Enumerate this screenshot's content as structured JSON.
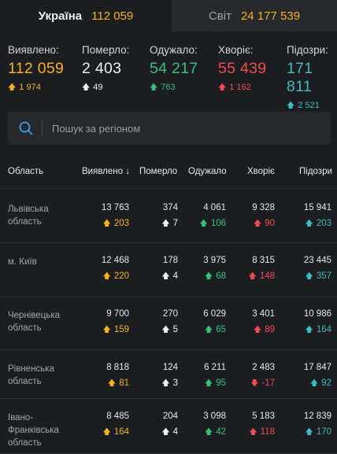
{
  "tabs": {
    "ukraine": {
      "label": "Україна",
      "count": "112 059"
    },
    "world": {
      "label": "Світ",
      "count": "24 177 539"
    }
  },
  "stats": [
    {
      "label": "Виявлено:",
      "value": "112 059",
      "delta": "1 974",
      "color": "#f6b21b",
      "arrow": "up"
    },
    {
      "label": "Померло:",
      "value": "2 403",
      "delta": "49",
      "color": "#eef0f2",
      "arrow": "up"
    },
    {
      "label": "Одужало:",
      "value": "54 217",
      "delta": "763",
      "color": "#35c07d",
      "arrow": "up"
    },
    {
      "label": "Хворіє:",
      "value": "55 439",
      "delta": "1 162",
      "color": "#f04b52",
      "arrow": "up"
    },
    {
      "label": "Підозри:",
      "value": "171 811",
      "delta": "2 521",
      "color": "#3dbcc1",
      "arrow": "up"
    }
  ],
  "search": {
    "placeholder": "Пошук за регіоном",
    "icon": "search-icon"
  },
  "table": {
    "headers": {
      "region": "Область",
      "detected": "Виявлено",
      "sort_arrow": "↓",
      "died": "Померло",
      "recovered": "Одужало",
      "sick": "Хворіє",
      "suspected": "Підозри"
    },
    "rows": [
      {
        "region": [
          "Львівська",
          "область"
        ],
        "detected": "13 763",
        "detected_d": "203",
        "died": "374",
        "died_d": "7",
        "recovered": "4 061",
        "recovered_d": "106",
        "sick": "9 328",
        "sick_d": "90",
        "sick_dir": "up",
        "suspected": "15 941",
        "suspected_d": "203"
      },
      {
        "region": [
          "м. Київ"
        ],
        "detected": "12 468",
        "detected_d": "220",
        "died": "178",
        "died_d": "4",
        "recovered": "3 975",
        "recovered_d": "68",
        "sick": "8 315",
        "sick_d": "148",
        "sick_dir": "up",
        "suspected": "23 445",
        "suspected_d": "357"
      },
      {
        "region": [
          "Чернівецька",
          "область"
        ],
        "detected": "9 700",
        "detected_d": "159",
        "died": "270",
        "died_d": "5",
        "recovered": "6 029",
        "recovered_d": "65",
        "sick": "3 401",
        "sick_d": "89",
        "sick_dir": "up",
        "suspected": "10 986",
        "suspected_d": "164"
      },
      {
        "region": [
          "Рівненська",
          "область"
        ],
        "detected": "8 818",
        "detected_d": "81",
        "died": "124",
        "died_d": "3",
        "recovered": "6 211",
        "recovered_d": "95",
        "sick": "2 483",
        "sick_d": "-17",
        "sick_dir": "down",
        "suspected": "17 847",
        "suspected_d": "92"
      },
      {
        "region": [
          "Івано-",
          "Франківська",
          "область"
        ],
        "detected": "8 485",
        "detected_d": "164",
        "died": "204",
        "died_d": "4",
        "recovered": "3 098",
        "recovered_d": "42",
        "sick": "5 183",
        "sick_d": "118",
        "sick_dir": "up",
        "suspected": "12 839",
        "suspected_d": "170"
      }
    ]
  }
}
